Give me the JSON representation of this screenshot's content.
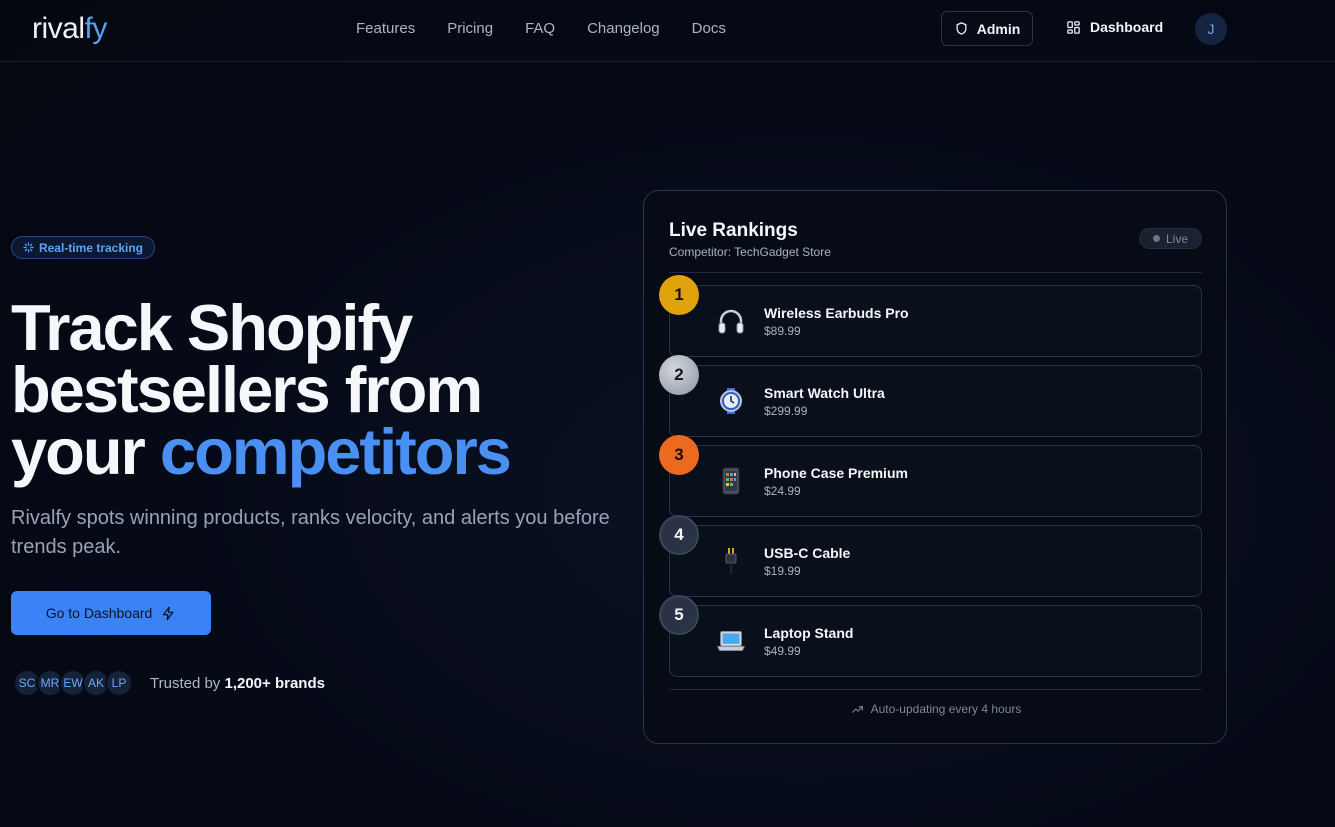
{
  "header": {
    "logo_main": "rival",
    "logo_accent": "fy",
    "nav": [
      "Features",
      "Pricing",
      "FAQ",
      "Changelog",
      "Docs"
    ],
    "admin_label": "Admin",
    "dashboard_label": "Dashboard",
    "user_initial": "J"
  },
  "hero": {
    "badge": "Real-time tracking",
    "headline_line1": "Track Shopify",
    "headline_line2": "bestsellers from",
    "headline_line3_plain": "your ",
    "headline_line3_accent": "competitors",
    "subtext": "Rivalfy spots winning products, ranks velocity, and alerts you before trends peak.",
    "cta_label": "Go to Dashboard",
    "avatars": [
      "SC",
      "MR",
      "EW",
      "AK",
      "LP"
    ],
    "trust_prefix": "Trusted by ",
    "trust_bold": "1,200+ brands"
  },
  "rankings": {
    "title": "Live Rankings",
    "subtitle": "Competitor: TechGadget Store",
    "live_label": "Live",
    "items": [
      {
        "rank": "1",
        "name": "Wireless Earbuds Pro",
        "price": "$89.99",
        "icon": "headphones-icon"
      },
      {
        "rank": "2",
        "name": "Smart Watch Ultra",
        "price": "$299.99",
        "icon": "watch-icon"
      },
      {
        "rank": "3",
        "name": "Phone Case Premium",
        "price": "$24.99",
        "icon": "phone-case-icon"
      },
      {
        "rank": "4",
        "name": "USB-C Cable",
        "price": "$19.99",
        "icon": "cable-icon"
      },
      {
        "rank": "5",
        "name": "Laptop Stand",
        "price": "$49.99",
        "icon": "laptop-icon"
      }
    ],
    "footer": "Auto-updating every 4 hours"
  },
  "colors": {
    "accent": "#3b82f6",
    "background": "#060a17",
    "gold": "#e0a20d",
    "silver": "#b8bdc5",
    "bronze": "#ec6a1f"
  }
}
